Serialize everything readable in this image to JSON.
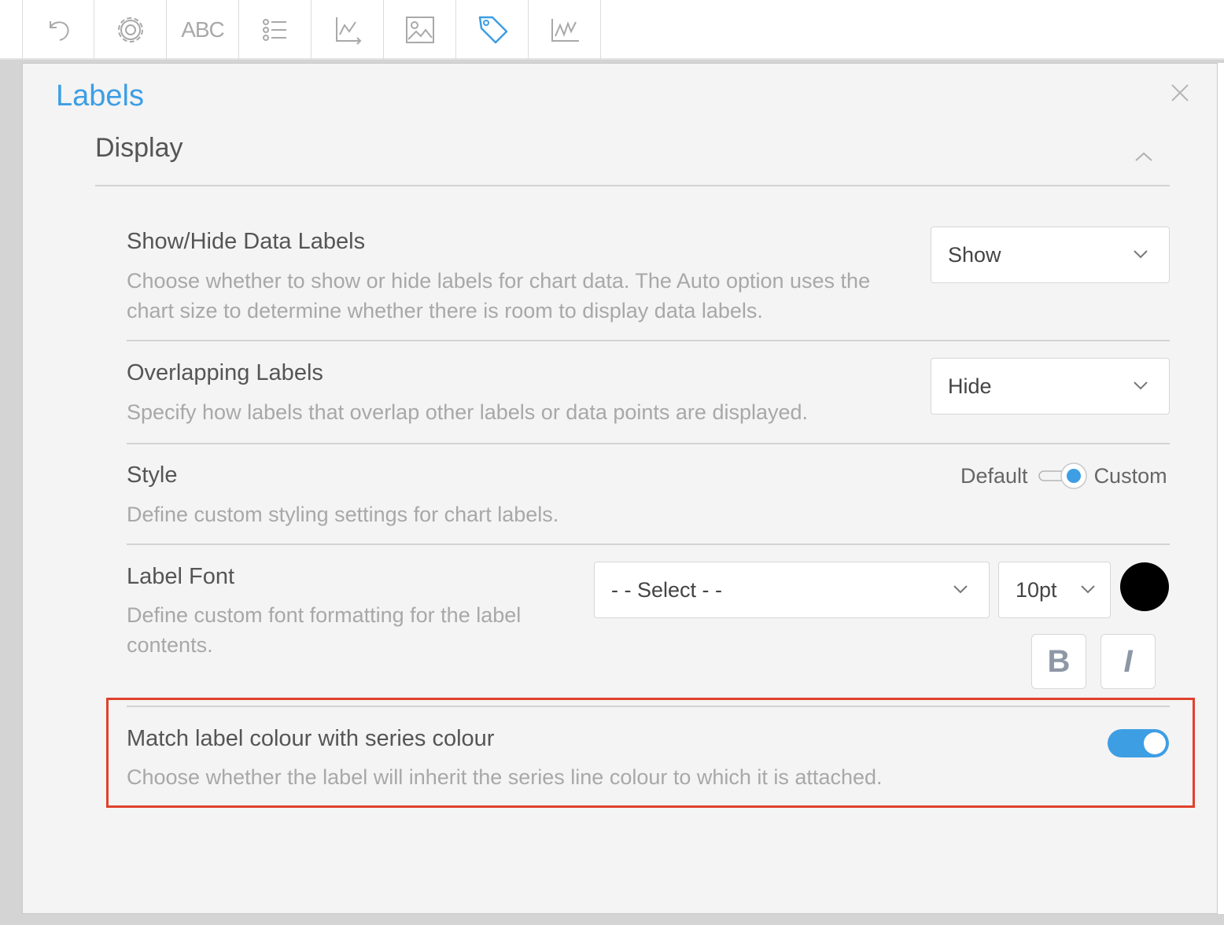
{
  "toolbar": {
    "items": [
      {
        "name": "undo-icon"
      },
      {
        "name": "gear-icon"
      },
      {
        "name": "abc-text-icon",
        "label": "ABC"
      },
      {
        "name": "list-icon"
      },
      {
        "name": "axis-icon"
      },
      {
        "name": "image-icon"
      },
      {
        "name": "tag-icon",
        "active": true
      },
      {
        "name": "line-chart-icon"
      }
    ],
    "accent": "#3d9ee4"
  },
  "panel": {
    "title": "Labels",
    "section": "Display",
    "rows": {
      "show_hide": {
        "title": "Show/Hide Data Labels",
        "desc": "Choose whether to show or hide labels for chart data. The Auto option uses the chart size to determine whether there is room to display data labels.",
        "value": "Show"
      },
      "overlapping": {
        "title": "Overlapping Labels",
        "desc": "Specify how labels that overlap other labels or data points are displayed.",
        "value": "Hide"
      },
      "style": {
        "title": "Style",
        "desc": "Define custom styling settings for chart labels.",
        "option_default": "Default",
        "option_custom": "Custom",
        "selected": "Custom"
      },
      "label_font": {
        "title": "Label Font",
        "desc": "Define custom font formatting for the label contents.",
        "font_value": "- - Select - -",
        "size_value": "10pt",
        "color": "#000000",
        "bold_label": "B",
        "italic_label": "I"
      },
      "match_colour": {
        "title": "Match label colour with series colour",
        "desc": "Choose whether the label will inherit the series line colour to which it is attached.",
        "enabled": true
      }
    }
  },
  "colors": {
    "title_blue": "#3d9ee4",
    "highlight_red": "#e0412c"
  }
}
